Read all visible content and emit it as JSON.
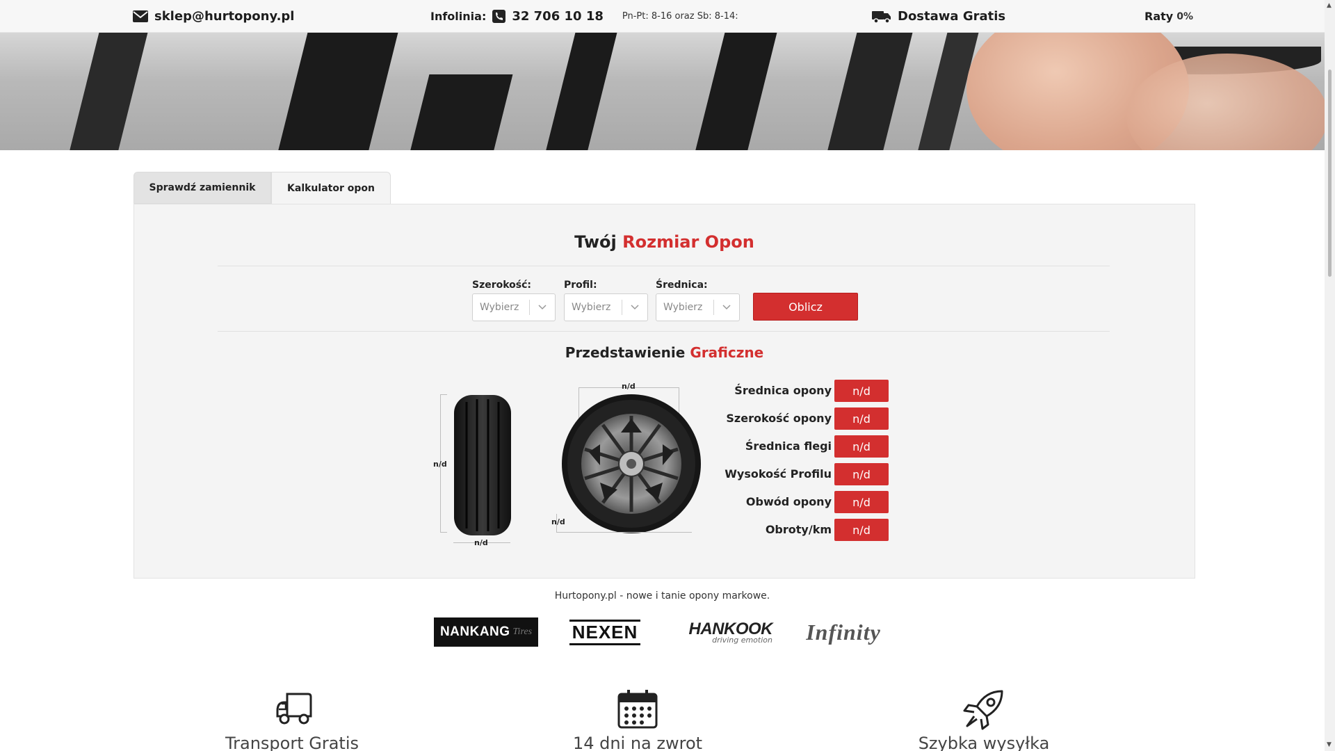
{
  "topbar": {
    "email": "sklep@hurtopony.pl",
    "infolinia_label": "Infolinia:",
    "phone": "32 706 10 18",
    "hours": "Pn-Pt: 8-16 oraz Sb: 8-14:",
    "delivery": "Dostawa Gratis",
    "raty_label": "Raty",
    "raty_value": "0%"
  },
  "tabs": [
    {
      "label": "Sprawdź zamiennik"
    },
    {
      "label": "Kalkulator opon"
    }
  ],
  "calculator": {
    "title_black": "Twój",
    "title_red": "Rozmiar Opon",
    "fields": [
      {
        "label": "Szerokość:",
        "placeholder": "Wybierz"
      },
      {
        "label": "Profil:",
        "placeholder": "Wybierz"
      },
      {
        "label": "Średnica:",
        "placeholder": "Wybierz"
      }
    ],
    "button": "Oblicz"
  },
  "graphic": {
    "title_black": "Przedstawienie",
    "title_red": "Graficzne",
    "tire_height": "n/d",
    "tire_width": "n/d",
    "wheel_rim": "n/d",
    "wheel_profile": "n/d",
    "specs": [
      {
        "label": "Średnica opony",
        "value": "n/d"
      },
      {
        "label": "Szerokość opony",
        "value": "n/d"
      },
      {
        "label": "Średnica flegi",
        "value": "n/d"
      },
      {
        "label": "Wysokość Profilu",
        "value": "n/d"
      },
      {
        "label": "Obwód opony",
        "value": "n/d"
      },
      {
        "label": "Obroty/km",
        "value": "n/d"
      }
    ]
  },
  "footer_text": "Hurtopony.pl - nowe i tanie opony markowe.",
  "brands": [
    "NANKANG",
    "Tires",
    "NEXEN",
    "HANKOOK",
    "driving emotion",
    "Infinity"
  ],
  "features": [
    {
      "label": "Transport Gratis",
      "icon": "truck-icon"
    },
    {
      "label": "14 dni na zwrot",
      "icon": "calendar-icon"
    },
    {
      "label": "Szybka wysyłka",
      "icon": "rocket-icon"
    }
  ],
  "colors": {
    "accent": "#d32f2f",
    "panel": "#f4f4f4",
    "topbar": "#f7f7f7"
  }
}
